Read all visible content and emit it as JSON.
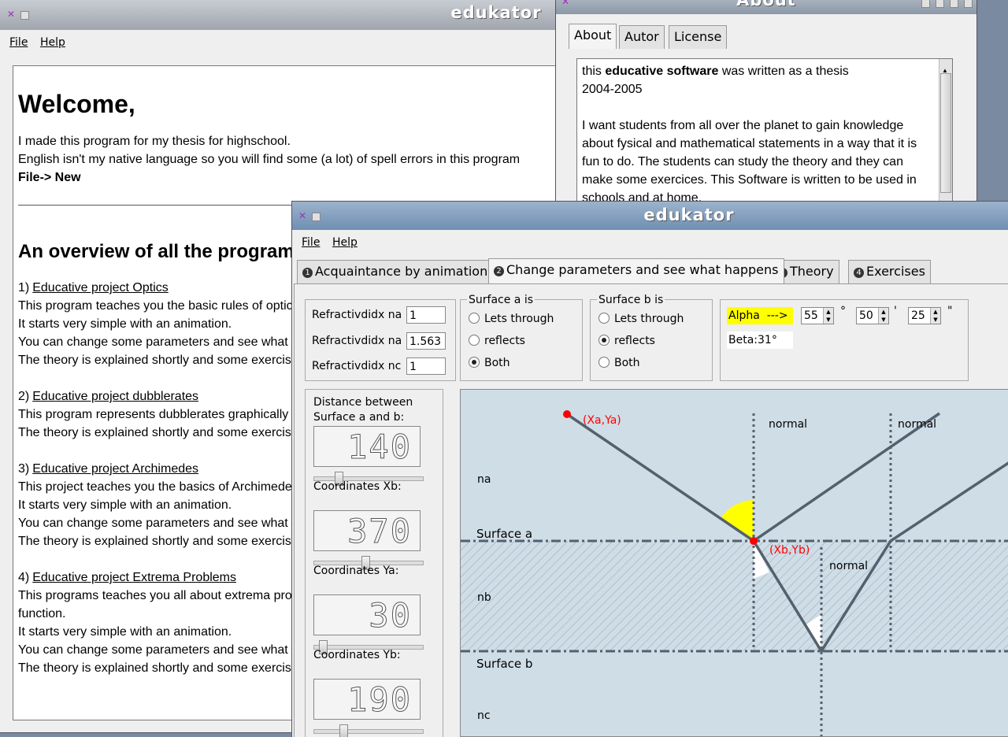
{
  "windows": {
    "welcome": {
      "title": "edukator",
      "menu": {
        "file": "File",
        "help": "Help"
      },
      "heading": "Welcome,",
      "intro_lines": [
        "I made this program for my thesis for highschool.",
        "English isn't my native language so you will find some (a lot) of spell errors in this program"
      ],
      "file_new": "File-> New",
      "overview_heading": "An overview of all the programs",
      "projects": [
        {
          "number": "1)",
          "name": "Educative project Optics",
          "lines": [
            "This program teaches you the basic rules of optics",
            "It starts very simple with an animation.",
            "You can change some parameters and see what happens",
            "The theory is explained shortly and some exercises"
          ]
        },
        {
          "number": "2)",
          "name": "Educative project dubblerates",
          "lines": [
            "This program represents dubblerates graphically",
            "The theory is explained shortly and some exercises"
          ]
        },
        {
          "number": "3)",
          "name": "Educative project Archimedes",
          "lines": [
            "This project teaches you the basics of Archimedes",
            "It starts very simple with an animation.",
            "You can change some parameters and see what happens",
            "The theory is explained shortly and some exercises"
          ]
        },
        {
          "number": "4)",
          "name": "Educative project Extrema Problems",
          "lines": [
            "This programs teaches you all about extrema problems of a",
            "function.",
            "It starts very simple with an animation.",
            "You can change some parameters and see what happens",
            "The theory is explained shortly and some exercises"
          ]
        }
      ]
    },
    "about": {
      "title": "About",
      "tabs": [
        "About",
        "Autor",
        "License"
      ],
      "text_prefix": "this ",
      "text_bold": "educative software",
      "text_suffix": " was written as a thesis",
      "years": "2004-2005",
      "paragraph_lines": [
        "I want students from all over the planet to gain knowledge",
        "about fysical and mathematical statements in a way that it is",
        "fun to do. The students can study the theory and they can",
        "make some exercices. This Software is written to be used in",
        "schools and at home."
      ]
    },
    "optics": {
      "title": "edukator",
      "menu": {
        "file": "File",
        "help": "Help"
      },
      "tabs": [
        {
          "num": "1",
          "label": "Acquaintance by animation"
        },
        {
          "num": "2",
          "label": "Change parameters and see what happens"
        },
        {
          "num": "3",
          "label": "Theory"
        },
        {
          "num": "4",
          "label": "Exercises"
        }
      ],
      "refractive": [
        {
          "label": "Refractivdidx na",
          "value": "1"
        },
        {
          "label": "Refractivdidx na",
          "value": "1.563"
        },
        {
          "label": "Refractivdidx nc",
          "value": "1"
        }
      ],
      "surface_a": {
        "title": "Surface a is",
        "options": [
          "Lets through",
          "reflects",
          "Both"
        ],
        "selected": 2
      },
      "surface_b": {
        "title": "Surface b is",
        "options": [
          "Lets through",
          "reflects",
          "Both"
        ],
        "selected": 1
      },
      "alpha": {
        "label": "Alpha  --->",
        "degrees": "55",
        "minutes": "50",
        "seconds": "25",
        "deg_sym": "°",
        "min_sym": "'",
        "sec_sym": "\""
      },
      "beta": "Beta:31°",
      "lcds": [
        {
          "label_line1": "Distance between",
          "label_line2": "Surface a and b:",
          "value": "140",
          "slider": 0.2
        },
        {
          "label_line1": "Coordinates Xb:",
          "label_line2": "",
          "value": "370",
          "slider": 0.47
        },
        {
          "label_line1": "Coordinates Ya:",
          "label_line2": "",
          "value": "30",
          "slider": 0.05
        },
        {
          "label_line1": "Coordinates Yb:",
          "label_line2": "",
          "value": "190",
          "slider": 0.25
        }
      ],
      "diagram": {
        "point_a": "(Xa,Ya)",
        "point_b": "(Xb,Yb)",
        "normal": "normal",
        "na": "na",
        "nb": "nb",
        "nc": "nc",
        "surface_a": "Surface a",
        "surface_b": "Surface b"
      }
    }
  },
  "colors": {
    "title_active": "#7f9cbd",
    "diagram_bg": "#cfdde6",
    "ray": "#55606e",
    "point": "#ff0000",
    "alpha_highlight": "#ffff00"
  }
}
